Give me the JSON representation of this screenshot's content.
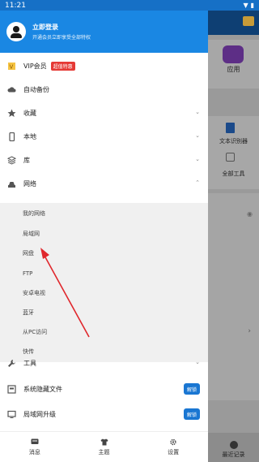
{
  "statusbar": {
    "time": "11:21"
  },
  "header": {
    "title": "立即登录",
    "subtitle": "开通会员立即享受全部特权"
  },
  "menu": {
    "vip": "VIP会员",
    "vip_badge": "超值特惠",
    "backup": "自动备份",
    "favorites": "收藏",
    "local": "本地",
    "library": "库",
    "network": "网络",
    "tools": "工具",
    "hidden_files": "系统隐藏文件",
    "lan_upgrade": "局域网升级",
    "unlock": "解锁"
  },
  "network_items": [
    "我的网络",
    "局域网",
    "网盘",
    "FTP",
    "安卓电视",
    "蓝牙",
    "从PC访问",
    "快传"
  ],
  "bottom_nav": {
    "messages": "消息",
    "theme": "主题",
    "settings": "设置"
  },
  "background": {
    "apps": "应用",
    "doc_recognition": "文本识别器",
    "full_tools": "全部工具",
    "recent": "最近记录"
  },
  "colors": {
    "header": "#1a87e3",
    "status": "#1670c6",
    "badge": "#e53935",
    "unlock": "#1976d2",
    "arrow": "#e0272c"
  }
}
